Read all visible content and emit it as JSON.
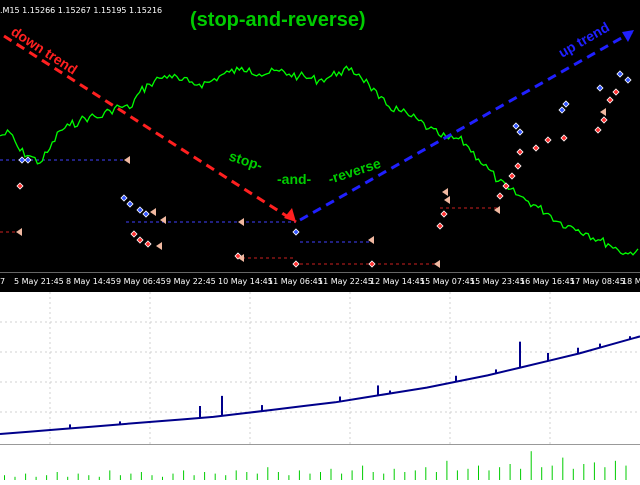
{
  "header": {
    "symbol_info": ".M15  1.15266 1.15267 1.15195 1.15216",
    "title": "(stop-and-reverse)"
  },
  "annotations": {
    "down_trend": "down trend",
    "up_trend": "up trend",
    "stop": "stop-",
    "and": "-and-",
    "reverse": "-reverse"
  },
  "time_axis": {
    "labels": [
      "7",
      "5 May 21:45",
      "8 May 14:45",
      "9 May 06:45",
      "9 May 22:45",
      "10 May 14:45",
      "11 May 06:45",
      "11 May 22:45",
      "12 May 14:45",
      "15 May 07:45",
      "15 May 23:45",
      "16 May 16:45",
      "17 May 08:45",
      "18 M"
    ]
  },
  "colors": {
    "price_line": "#00ff00",
    "title": "#00cc00",
    "down_trend": "#ff2020",
    "up_trend": "#2020ff",
    "balance_line": "#00008b",
    "volume_bar": "#00cc00"
  },
  "icons": {
    "buy_marker": "blue-diamond-icon",
    "sell_marker": "red-diamond-icon",
    "close_marker": "arrow-left-icon"
  },
  "chart_data": [
    {
      "type": "line",
      "name": "price-chart",
      "series": [
        {
          "values": [
            185,
            188,
            170,
            165,
            158,
            172,
            190,
            195,
            200,
            204,
            203,
            210,
            214,
            212,
            228,
            236,
            242,
            245,
            240,
            238,
            236,
            238,
            244,
            248,
            250,
            252,
            246,
            247,
            249,
            246,
            244,
            242,
            240,
            243,
            248,
            250,
            246,
            236,
            222,
            214,
            210,
            205,
            200,
            192,
            186,
            182,
            182,
            174,
            162,
            152,
            140,
            132,
            126,
            120,
            114,
            108,
            100,
            96,
            92,
            88,
            82,
            78,
            72,
            68,
            73
          ]
        }
      ],
      "ylim": [
        60,
        260
      ]
    },
    {
      "type": "line",
      "name": "balance-chart",
      "series": [
        {
          "values": [
            0,
            2,
            4,
            6,
            8,
            10,
            12,
            14,
            17,
            20,
            23,
            26,
            30,
            34,
            38,
            43,
            48,
            54,
            60,
            66,
            73,
            80
          ]
        }
      ],
      "ylim": [
        0,
        100
      ]
    },
    {
      "type": "bar",
      "name": "volume-chart",
      "values": [
        3,
        2,
        4,
        2,
        3,
        5,
        2,
        4,
        3,
        2,
        6,
        3,
        4,
        5,
        3,
        2,
        4,
        6,
        3,
        5,
        4,
        3,
        6,
        5,
        4,
        8,
        5,
        3,
        6,
        4,
        5,
        7,
        4,
        6,
        9,
        5,
        4,
        7,
        5,
        6,
        8,
        5,
        12,
        6,
        7,
        9,
        6,
        8,
        10,
        7,
        18,
        8,
        9,
        14,
        7,
        10,
        11,
        8,
        12,
        9
      ],
      "ylim": [
        0,
        20
      ]
    }
  ]
}
